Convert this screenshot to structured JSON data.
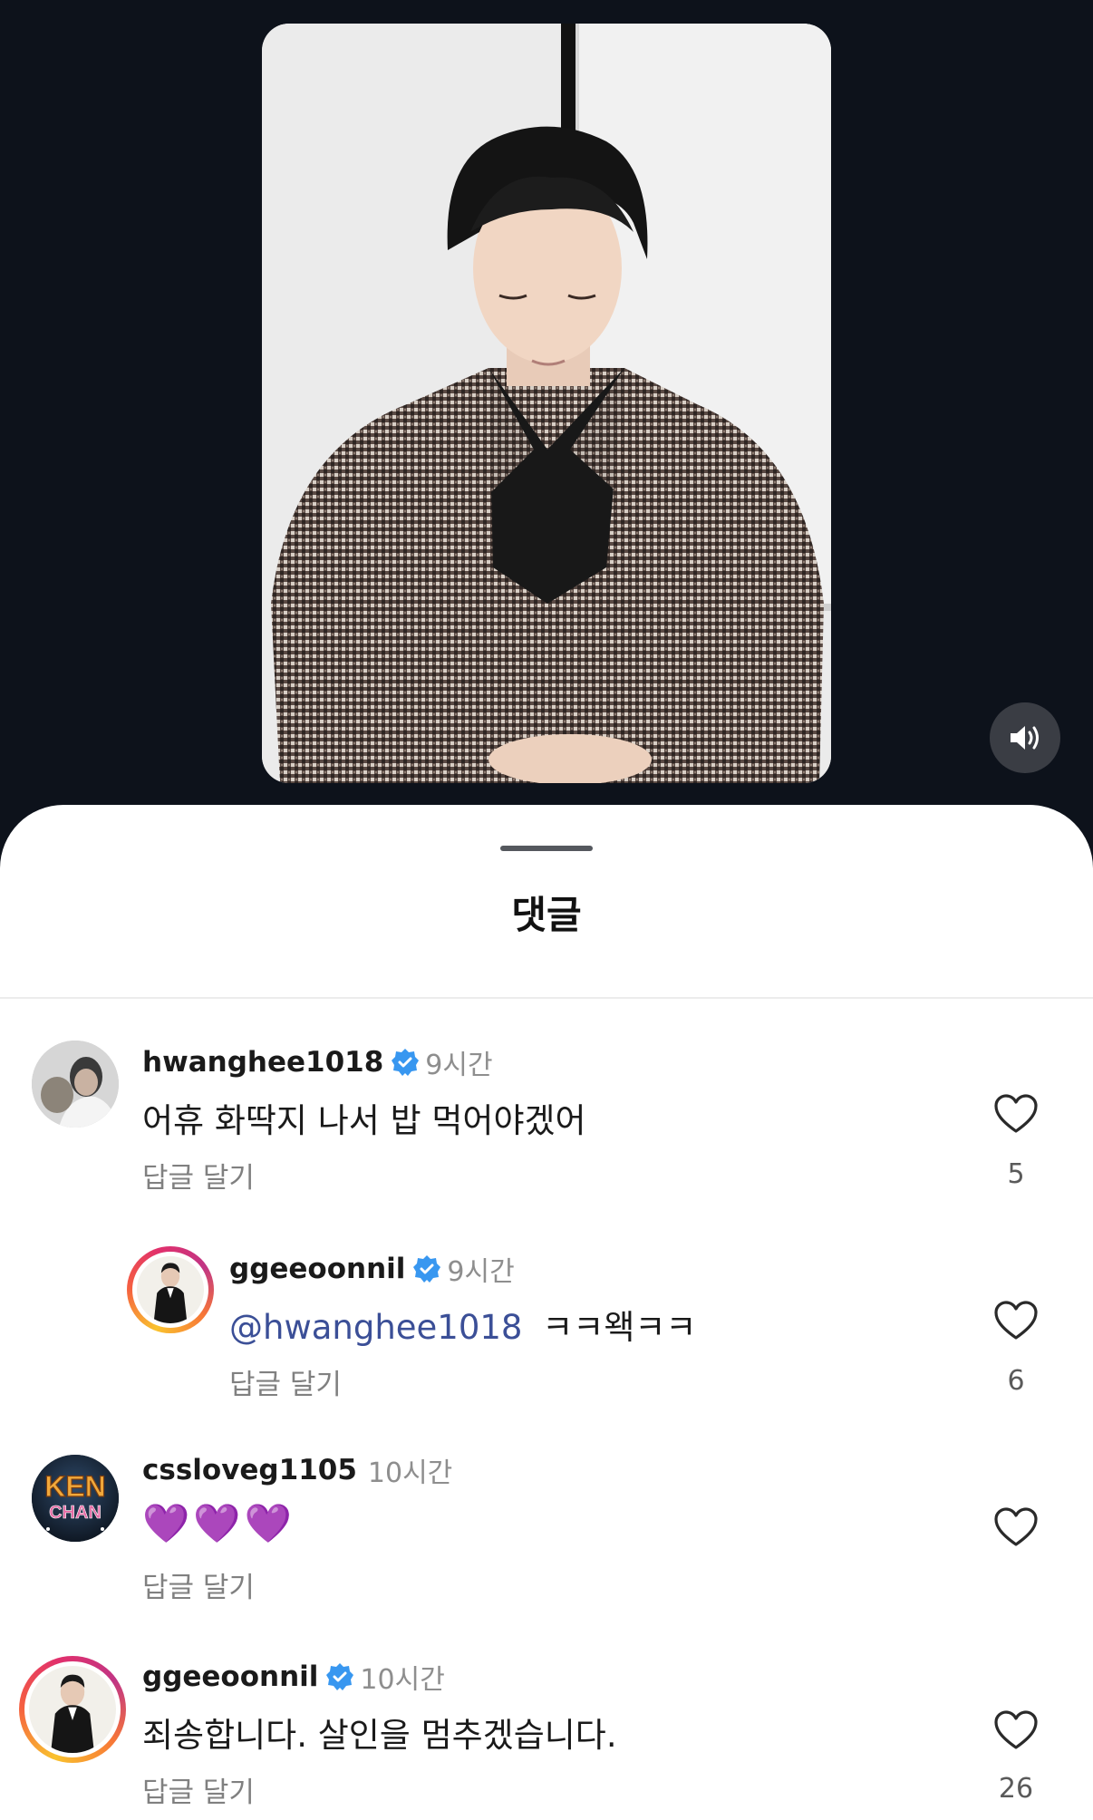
{
  "sheet": {
    "title": "댓글"
  },
  "comments": [
    {
      "username": "hwanghee1018",
      "verified": true,
      "time": "9시간",
      "text": "어휴 화딱지 나서 밥 먹어야겠어",
      "reply_label": "답글 달기",
      "likes": "5"
    },
    {
      "username": "ggeeoonnil",
      "verified": true,
      "time": "9시간",
      "mention": "@hwanghee1018",
      "text": "ㅋㅋ왝ㅋㅋ",
      "reply_label": "답글 달기",
      "likes": "6"
    },
    {
      "username": "cssloveg1105",
      "verified": false,
      "time": "10시간",
      "text": "💜💜💜",
      "reply_label": "답글 달기",
      "likes": ""
    },
    {
      "username": "ggeeoonnil",
      "verified": true,
      "time": "10시간",
      "text": "죄송합니다. 살인을 멈추겠습니다.",
      "reply_label": "답글 달기",
      "likes": "26"
    }
  ],
  "avatar_badge": {
    "line1": "KEN",
    "line2": "CHAN"
  },
  "colors": {
    "background": "#0d121b",
    "sheet": "#ffffff",
    "verified": "#3897f0",
    "mention": "#3b4f97",
    "secondary_text": "#8e8e8e"
  }
}
